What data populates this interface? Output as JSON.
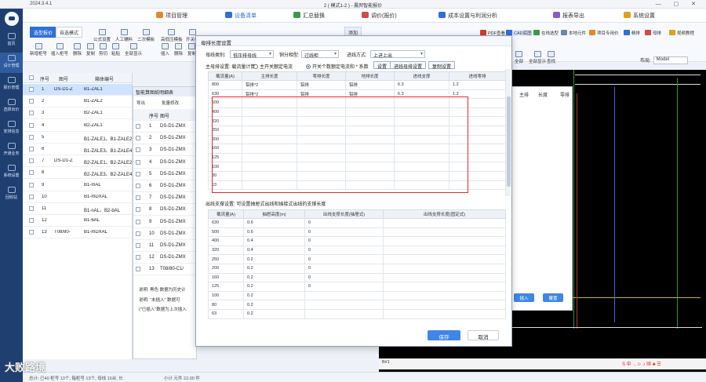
{
  "app": {
    "version": "2024.3.4.1",
    "window_title": "2 ( 模式1-2 ) - 晨羿智能报价",
    "controls": "— ▢ ✕"
  },
  "nav": {
    "items": [
      {
        "label": "首页"
      },
      {
        "label": "设计管理"
      },
      {
        "label": "报价管理"
      },
      {
        "label": "选择出价"
      },
      {
        "label": "安排信息"
      },
      {
        "label": "开通业务"
      },
      {
        "label": "系统设置"
      },
      {
        "label": "回收站"
      }
    ]
  },
  "menu": {
    "items": [
      {
        "label": "项目管理",
        "color": "#e08a2a"
      },
      {
        "label": "设备清单",
        "color": "#2f6fd8"
      },
      {
        "label": "汇总替换",
        "color": "#3a9a4a"
      },
      {
        "label": "调价(报价)",
        "color": "#d04a4a"
      },
      {
        "label": "成本设置与利润分析",
        "color": "#2f6fd8"
      },
      {
        "label": "报表导出",
        "color": "#8a5ad0"
      },
      {
        "label": "系统设置",
        "color": "#e0a020"
      }
    ]
  },
  "ribbon": {
    "mode_tabs": [
      "选型报价",
      "自选模式"
    ],
    "add_tab": "添加",
    "tools_row1": [
      "公式设置",
      "人工辅料",
      "二次模板",
      "高低压模板",
      "开关柜"
    ],
    "tools_row2": [
      "新增柜号",
      "插入柜号",
      "删除",
      "复制",
      "剪切",
      "粘贴",
      "全部显示"
    ],
    "tools_mid": [
      "插入",
      "删除",
      "复制"
    ],
    "right_tools": [
      "PDF查看",
      "CAD底图",
      "在线选型",
      "本地元件",
      "项目专用价",
      "精排",
      "母排",
      "视频教程"
    ],
    "icons_right": [
      "全部",
      "全部显示",
      "查找"
    ]
  },
  "left_grid": {
    "headers": [
      "序号",
      "图号",
      "箱体编号"
    ],
    "rows": [
      {
        "no": "1",
        "fig": "DS-D1-Z",
        "box": "B1-ZAL1"
      },
      {
        "no": "2",
        "fig": "",
        "box": "B1-ZAL2"
      },
      {
        "no": "3",
        "fig": "",
        "box": "B2-ZAL1"
      },
      {
        "no": "4",
        "fig": "",
        "box": "B2-ZAL1"
      },
      {
        "no": "5",
        "fig": "",
        "box": "B1-ZALE1、B1-ZALE2"
      },
      {
        "no": "6",
        "fig": "",
        "box": "B1-ZALE3、B1-ZALE4"
      },
      {
        "no": "7",
        "fig": "DS-D1-Z",
        "box": "B2-ZALE1、B2-ZALE2"
      },
      {
        "no": "8",
        "fig": "",
        "box": "B2-ZALE3、B2-ZALE4"
      },
      {
        "no": "9",
        "fig": "",
        "box": "B1-mAL"
      },
      {
        "no": "10",
        "fig": "",
        "box": "B1-mDXAL"
      },
      {
        "no": "11",
        "fig": "",
        "box": "B1-nAL、B2-bAL"
      },
      {
        "no": "12",
        "fig": "",
        "box": "B1-6AL"
      },
      {
        "no": "13",
        "fig": "T08/80-",
        "box": "B1-mDXAL"
      }
    ]
  },
  "mid_panel": {
    "title": "智能算图纸明细表",
    "tools": [
      "导出",
      "批量修改"
    ],
    "headers": [
      "序号",
      "图号"
    ],
    "rows": [
      {
        "no": "1",
        "fig": "DS-D1-ZMX"
      },
      {
        "no": "2",
        "fig": "DS-D1-ZMX"
      },
      {
        "no": "3",
        "fig": "DS-D1-ZMX"
      },
      {
        "no": "4",
        "fig": "DS-D1-ZMX"
      },
      {
        "no": "5",
        "fig": "DS-D1-ZMX"
      },
      {
        "no": "6",
        "fig": "DS-D1-ZMX"
      },
      {
        "no": "7",
        "fig": "DS-D1-ZMX"
      },
      {
        "no": "8",
        "fig": "DS-D1-ZMX"
      },
      {
        "no": "9",
        "fig": "DS-D1-ZMX"
      },
      {
        "no": "10",
        "fig": "DS-D1-ZMX"
      },
      {
        "no": "11",
        "fig": "DS-D1-ZMX"
      },
      {
        "no": "12",
        "fig": "DS-D1-ZMX"
      },
      {
        "no": "13",
        "fig": "T08/80-C1/"
      }
    ],
    "notes": [
      "说明: 黑色 数据为历史计",
      "说明: \"未插入\" 数据可",
      "(\"已插入\"数据为上次插入"
    ]
  },
  "dialog": {
    "title": "母排长度设置",
    "row1": {
      "label_cat": "母线类别:",
      "cat": "低压排母线",
      "label_model": "铜分相型:",
      "model": "过线柜",
      "label_way": "进线方式:",
      "way": "上进上出"
    },
    "row2": {
      "label": "主母排设置: 载流量计算:",
      "opt1": "主开关额定电流",
      "opt2": "开关个数额定电流和 * 系数",
      "btn_set": "设置",
      "btn_in": "进线母排设置",
      "btn_copy": "复制设置"
    },
    "table1": {
      "headers": [
        "载流量(A)",
        "主排长度",
        "零排长度",
        "地排长度",
        "进线支撑",
        "进线零排"
      ],
      "rows": [
        [
          "800",
          "铝排*2",
          "铝排",
          "铝排",
          "6.3",
          "1.2"
        ],
        [
          "630",
          "铝排*2",
          "铝排",
          "铝排",
          "6.3",
          "1.2"
        ],
        [
          "500",
          "",
          "",
          "",
          "",
          ""
        ],
        [
          "400",
          "",
          "",
          "",
          "",
          ""
        ],
        [
          "320",
          "",
          "",
          "",
          "",
          ""
        ],
        [
          "250",
          "",
          "",
          "",
          "",
          ""
        ],
        [
          "200",
          "",
          "",
          "",
          "",
          ""
        ],
        [
          "160",
          "",
          "",
          "",
          "",
          ""
        ],
        [
          "125",
          "",
          "",
          "",
          "",
          ""
        ],
        [
          "100",
          "",
          "",
          "",
          "",
          ""
        ],
        [
          "80",
          "",
          "",
          "",
          "",
          ""
        ],
        [
          "63",
          "",
          "",
          "",
          "",
          ""
        ]
      ]
    },
    "out_label": "出线支撑设置: 可设置抽屉式出线和插接式出线的支撑长度",
    "table2": {
      "headers": [
        "载流量(A)",
        "抽屉高度(m)",
        "出线支撑长度(抽屉式)",
        "出线支撑长度(固定式)"
      ],
      "rows": [
        [
          "630",
          "0.6",
          "0",
          ""
        ],
        [
          "500",
          "0.6",
          "0",
          ""
        ],
        [
          "400",
          "0.4",
          "0",
          ""
        ],
        [
          "320",
          "0.4",
          "0",
          ""
        ],
        [
          "250",
          "0.2",
          "0",
          ""
        ],
        [
          "200",
          "0.2",
          "0",
          ""
        ],
        [
          "160",
          "0.2",
          "0",
          ""
        ],
        [
          "125",
          "0.2",
          "0",
          ""
        ],
        [
          "100",
          "0.2",
          "",
          ""
        ],
        [
          "80",
          "0.2",
          "",
          ""
        ],
        [
          "63",
          "0.2",
          "",
          ""
        ]
      ]
    },
    "save": "保存",
    "cancel": "取消"
  },
  "right_panel": {
    "headers": [
      "主排",
      "长度",
      "零排"
    ],
    "btn_insert": "插入",
    "btn_replace": "覆置"
  },
  "layout": {
    "label": "布局:",
    "value": "Model"
  },
  "statusbar": {
    "text": "总计: 已40 柜号 13个, 箱柜号 13个, 母线 16台, 长",
    "count": "小计 元件 22.00 件"
  },
  "watermark": "大败路境",
  "cad_tab": "B#1"
}
